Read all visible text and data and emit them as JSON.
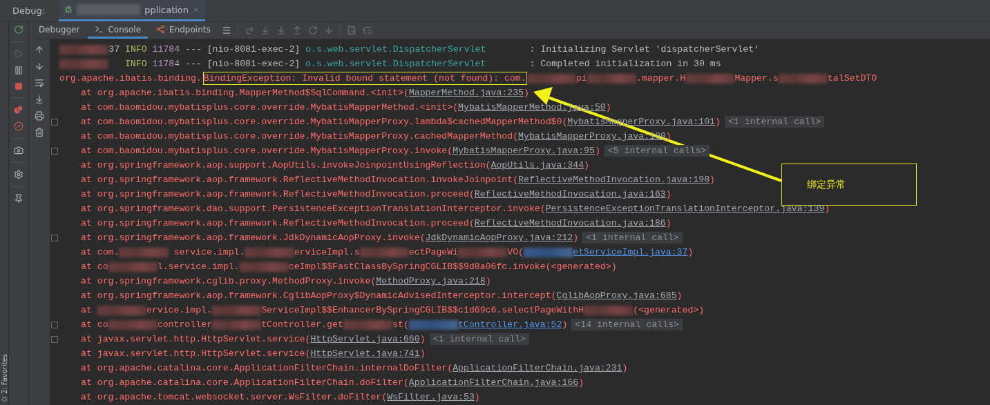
{
  "window": {
    "label": "Debug:",
    "session_tab": {
      "title": "pplication",
      "selected": true
    }
  },
  "tabs": [
    {
      "label": "Debugger",
      "kind": "debugger",
      "selected": false
    },
    {
      "label": "Console",
      "kind": "console",
      "selected": true
    },
    {
      "label": "Endpoints",
      "kind": "endpoints",
      "selected": false
    }
  ],
  "console": {
    "lines": [
      {
        "kind": "log",
        "expandable": false,
        "segments": [
          {
            "kind": "redacted"
          },
          {
            "kind": "text",
            "text": "37 "
          },
          {
            "kind": "level",
            "text": "INFO"
          },
          {
            "kind": "pid",
            "text": " 11784"
          },
          {
            "kind": "text",
            "text": " --- [nio-8081-exec-2] "
          },
          {
            "kind": "logger",
            "text": "o.s.web.servlet.DispatcherServlet"
          },
          {
            "kind": "text",
            "text": "        : Initializing Servlet 'dispatcherServlet'"
          }
        ]
      },
      {
        "kind": "log",
        "expandable": false,
        "segments": [
          {
            "kind": "redacted"
          },
          {
            "kind": "level",
            "text": "   INFO"
          },
          {
            "kind": "pid",
            "text": " 11784"
          },
          {
            "kind": "text",
            "text": " --- [nio-8081-exec-2] "
          },
          {
            "kind": "logger",
            "text": "o.s.web.servlet.DispatcherServlet"
          },
          {
            "kind": "text",
            "text": "        : Completed initialization in 30 ms"
          }
        ]
      },
      {
        "kind": "error",
        "expandable": false,
        "segments": [
          {
            "kind": "text",
            "text": "org.apache.ibatis.binding."
          },
          {
            "kind": "boxed",
            "text": "BindingException: Invalid bound statement (not found): com."
          },
          {
            "kind": "redacted"
          },
          {
            "kind": "text",
            "text": "pi"
          },
          {
            "kind": "redacted"
          },
          {
            "kind": "text",
            "text": ".mapper.H"
          },
          {
            "kind": "redacted"
          },
          {
            "kind": "text",
            "text": "Mapper.s"
          },
          {
            "kind": "redacted"
          },
          {
            "kind": "text",
            "text": "talSetDTO"
          }
        ]
      },
      {
        "kind": "frame",
        "expandable": false,
        "segments": [
          {
            "kind": "text",
            "text": "at org.apache.ibatis.binding.MapperMethod$SqlCommand.<init>("
          },
          {
            "kind": "file",
            "text": "MapperMethod.java:235"
          },
          {
            "kind": "text",
            "text": ")"
          }
        ]
      },
      {
        "kind": "frame",
        "expandable": false,
        "segments": [
          {
            "kind": "text",
            "text": "at com.baomidou.mybatisplus.core.override.MybatisMapperMethod.<init>("
          },
          {
            "kind": "file",
            "text": "MybatisMapperMethod.java:50"
          },
          {
            "kind": "text",
            "text": ")"
          }
        ]
      },
      {
        "kind": "frame",
        "expandable": true,
        "segments": [
          {
            "kind": "text",
            "text": "at com.baomidou.mybatisplus.core.override.MybatisMapperProxy.lambda$cachedMapperMethod$0("
          },
          {
            "kind": "file",
            "text": "MybatisMapperProxy.java:101"
          },
          {
            "kind": "text",
            "text": ")"
          },
          {
            "kind": "internal",
            "text": "<1 internal call>"
          }
        ]
      },
      {
        "kind": "frame",
        "expandable": false,
        "segments": [
          {
            "kind": "text",
            "text": "at com.baomidou.mybatisplus.core.override.MybatisMapperProxy.cachedMapperMethod("
          },
          {
            "kind": "file",
            "text": "MybatisMapperProxy.java:100"
          },
          {
            "kind": "text",
            "text": ")"
          }
        ]
      },
      {
        "kind": "frame",
        "expandable": true,
        "segments": [
          {
            "kind": "text",
            "text": "at com.baomidou.mybatisplus.core.override.MybatisMapperProxy.invoke("
          },
          {
            "kind": "file",
            "text": "MybatisMapperProxy.java:95"
          },
          {
            "kind": "text",
            "text": ")"
          },
          {
            "kind": "internal",
            "text": "<5 internal calls>"
          }
        ]
      },
      {
        "kind": "frame",
        "expandable": false,
        "segments": [
          {
            "kind": "text",
            "text": "at org.springframework.aop.support.AopUtils.invokeJoinpointUsingReflection("
          },
          {
            "kind": "file",
            "text": "AopUtils.java:344"
          },
          {
            "kind": "text",
            "text": ")"
          }
        ]
      },
      {
        "kind": "frame",
        "expandable": false,
        "segments": [
          {
            "kind": "text",
            "text": "at org.springframework.aop.framework.ReflectiveMethodInvocation.invokeJoinpoint("
          },
          {
            "kind": "file",
            "text": "ReflectiveMethodInvocation.java:198"
          },
          {
            "kind": "text",
            "text": ")"
          }
        ]
      },
      {
        "kind": "frame",
        "expandable": false,
        "segments": [
          {
            "kind": "text",
            "text": "at org.springframework.aop.framework.ReflectiveMethodInvocation.proceed("
          },
          {
            "kind": "file",
            "text": "ReflectiveMethodInvocation.java:163"
          },
          {
            "kind": "text",
            "text": ")"
          }
        ]
      },
      {
        "kind": "frame",
        "expandable": false,
        "segments": [
          {
            "kind": "text",
            "text": "at org.springframework.dao.support.PersistenceExceptionTranslationInterceptor.invoke("
          },
          {
            "kind": "file",
            "text": "PersistenceExceptionTranslationInterceptor.java:139"
          },
          {
            "kind": "text",
            "text": ")"
          }
        ]
      },
      {
        "kind": "frame",
        "expandable": false,
        "segments": [
          {
            "kind": "text",
            "text": "at org.springframework.aop.framework.ReflectiveMethodInvocation.proceed("
          },
          {
            "kind": "file",
            "text": "ReflectiveMethodInvocation.java:186"
          },
          {
            "kind": "text",
            "text": ")"
          }
        ]
      },
      {
        "kind": "frame",
        "expandable": true,
        "segments": [
          {
            "kind": "text",
            "text": "at org.springframework.aop.framework.JdkDynamicAopProxy.invoke("
          },
          {
            "kind": "file",
            "text": "JdkDynamicAopProxy.java:212"
          },
          {
            "kind": "text",
            "text": ")"
          },
          {
            "kind": "internal",
            "text": "<1 internal call>"
          }
        ]
      },
      {
        "kind": "frame",
        "expandable": false,
        "segments": [
          {
            "kind": "text",
            "text": "at com."
          },
          {
            "kind": "redacted"
          },
          {
            "kind": "text",
            "text": " service.impl."
          },
          {
            "kind": "redacted"
          },
          {
            "kind": "text",
            "text": "erviceImpl.s"
          },
          {
            "kind": "redacted"
          },
          {
            "kind": "text",
            "text": "ectPageWi"
          },
          {
            "kind": "redacted"
          },
          {
            "kind": "text",
            "text": "VO("
          },
          {
            "kind": "redacted-link"
          },
          {
            "kind": "source",
            "text": "etServiceImpl.java:37"
          },
          {
            "kind": "text",
            "text": ")"
          }
        ]
      },
      {
        "kind": "frame",
        "expandable": false,
        "segments": [
          {
            "kind": "text",
            "text": "at co"
          },
          {
            "kind": "redacted"
          },
          {
            "kind": "text",
            "text": "l.service.impl."
          },
          {
            "kind": "redacted"
          },
          {
            "kind": "text",
            "text": "ceImpl$$FastClassBySpringCGLIB$$9d8a06fc.invoke(<generated>)"
          }
        ]
      },
      {
        "kind": "frame",
        "expandable": false,
        "segments": [
          {
            "kind": "text",
            "text": "at org.springframework.cglib.proxy.MethodProxy.invoke("
          },
          {
            "kind": "file",
            "text": "MethodProxy.java:218"
          },
          {
            "kind": "text",
            "text": ")"
          }
        ]
      },
      {
        "kind": "frame",
        "expandable": false,
        "segments": [
          {
            "kind": "text",
            "text": "at org.springframework.aop.framework.CglibAopProxy$DynamicAdvisedInterceptor.intercept("
          },
          {
            "kind": "file",
            "text": "CglibAopProxy.java:685"
          },
          {
            "kind": "text",
            "text": ")"
          }
        ]
      },
      {
        "kind": "frame",
        "expandable": false,
        "segments": [
          {
            "kind": "text",
            "text": "at "
          },
          {
            "kind": "redacted"
          },
          {
            "kind": "text",
            "text": "ervice.impl."
          },
          {
            "kind": "redacted"
          },
          {
            "kind": "text",
            "text": "ServiceImpl$$EnhancerBySpringCGLIB$$c1d69c6.selectPageWithH"
          },
          {
            "kind": "redacted"
          },
          {
            "kind": "text",
            "text": "(<generated>)"
          }
        ]
      },
      {
        "kind": "frame",
        "expandable": true,
        "segments": [
          {
            "kind": "text",
            "text": "at co"
          },
          {
            "kind": "redacted"
          },
          {
            "kind": "text",
            "text": "controller"
          },
          {
            "kind": "redacted"
          },
          {
            "kind": "text",
            "text": "tController.get"
          },
          {
            "kind": "redacted"
          },
          {
            "kind": "text",
            "text": "st("
          },
          {
            "kind": "redacted-link"
          },
          {
            "kind": "source",
            "text": "tController.java:52"
          },
          {
            "kind": "text",
            "text": ")"
          },
          {
            "kind": "internal",
            "text": "<14 internal calls>"
          }
        ]
      },
      {
        "kind": "frame",
        "expandable": true,
        "segments": [
          {
            "kind": "text",
            "text": "at javax.servlet.http.HttpServlet.service("
          },
          {
            "kind": "file",
            "text": "HttpServlet.java:660"
          },
          {
            "kind": "text",
            "text": ")"
          },
          {
            "kind": "internal",
            "text": "<1 internal call>"
          }
        ]
      },
      {
        "kind": "frame",
        "expandable": false,
        "segments": [
          {
            "kind": "text",
            "text": "at javax.servlet.http.HttpServlet.service("
          },
          {
            "kind": "file",
            "text": "HttpServlet.java:741"
          },
          {
            "kind": "text",
            "text": ")"
          }
        ]
      },
      {
        "kind": "frame",
        "expandable": false,
        "segments": [
          {
            "kind": "text",
            "text": "at org.apache.catalina.core.ApplicationFilterChain.internalDoFilter("
          },
          {
            "kind": "file",
            "text": "ApplicationFilterChain.java:231"
          },
          {
            "kind": "text",
            "text": ")"
          }
        ]
      },
      {
        "kind": "frame",
        "expandable": false,
        "segments": [
          {
            "kind": "text",
            "text": "at org.apache.catalina.core.ApplicationFilterChain.doFilter("
          },
          {
            "kind": "file",
            "text": "ApplicationFilterChain.java:166"
          },
          {
            "kind": "text",
            "text": ")"
          }
        ]
      },
      {
        "kind": "frame",
        "expandable": false,
        "segments": [
          {
            "kind": "text",
            "text": "at org.apache.tomcat.websocket.server.WsFilter.doFilter("
          },
          {
            "kind": "file",
            "text": "WsFilter.java:53"
          },
          {
            "kind": "text",
            "text": ")"
          }
        ]
      }
    ]
  },
  "annotation": {
    "text": "绑定异常"
  },
  "favorites": {
    "label": "2: Favorites"
  }
}
